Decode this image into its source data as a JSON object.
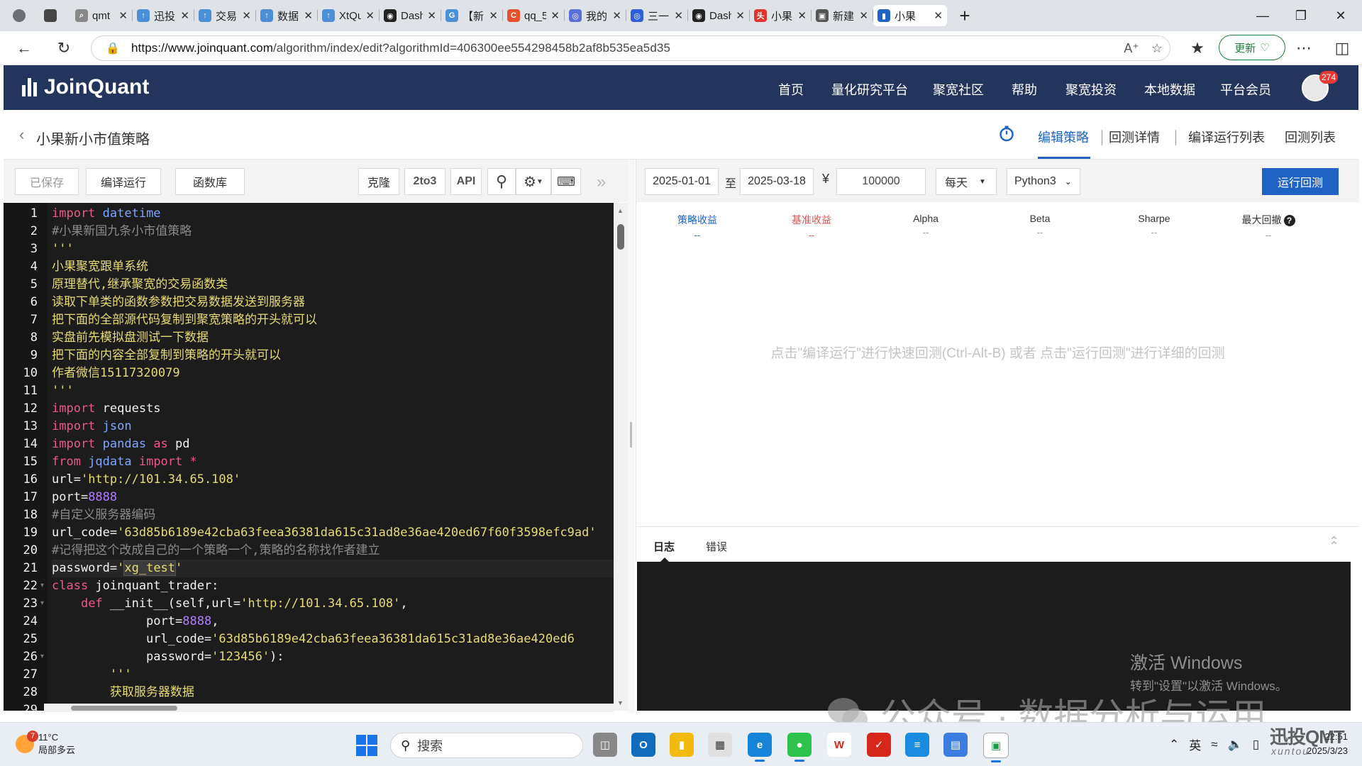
{
  "browser": {
    "tabs": [
      {
        "label": "",
        "icon": "profile-icon",
        "color": "#6b6f75"
      },
      {
        "label": "",
        "icon": "tab-actions-icon",
        "color": "#444444"
      },
      {
        "label": "qmt",
        "icon": "search-icon",
        "color": "#888888"
      },
      {
        "label": "迅投",
        "icon": "xuntou-icon",
        "color": "#4b8fd6"
      },
      {
        "label": "交易",
        "icon": "xuntou-icon",
        "color": "#4b8fd6"
      },
      {
        "label": "数据",
        "icon": "xuntou-icon",
        "color": "#4b8fd6"
      },
      {
        "label": "XtQu",
        "icon": "xuntou-icon",
        "color": "#4b8fd6"
      },
      {
        "label": "Dash",
        "icon": "dash-icon",
        "color": "#222222"
      },
      {
        "label": "【新",
        "icon": "gt-icon",
        "color": "#4b8fd6"
      },
      {
        "label": "qq_5",
        "icon": "csdn-icon",
        "color": "#e8512c"
      },
      {
        "label": "我的",
        "icon": "ai-icon",
        "color": "#5b6fd8"
      },
      {
        "label": "三一",
        "icon": "ai-icon",
        "color": "#2f5fd8"
      },
      {
        "label": "Dash",
        "icon": "dash-icon",
        "color": "#222222"
      },
      {
        "label": "小果",
        "icon": "toutiao-icon",
        "color": "#e5322d"
      },
      {
        "label": "新建",
        "icon": "new-tab-icon",
        "color": "#555555"
      },
      {
        "label": "小果",
        "icon": "joinquant-icon",
        "color": "#1e63c4",
        "active": true
      }
    ],
    "new_tab": "+",
    "url_host": "https://www.joinquant.com",
    "url_path": "/algorithm/index/edit?algorithmId=406300ee554298458b2af8b535ea5d35",
    "update_label": "更新"
  },
  "site": {
    "logo": "JoinQuant",
    "nav": [
      "首页",
      "量化研究平台",
      "聚宽社区",
      "帮助",
      "聚宽投资",
      "本地数据",
      "平台会员"
    ],
    "notification_count": "274"
  },
  "strategy": {
    "title": "小果新小市值策略",
    "subnav": [
      "编辑策略",
      "回测详情",
      "编译运行列表",
      "回测列表"
    ],
    "active_subnav": 0
  },
  "editor_toolbar": {
    "saved": "已保存",
    "compile_run": "编译运行",
    "library": "函数库",
    "clone": "克隆",
    "to3": "2to3",
    "api": "API"
  },
  "code": {
    "lines": [
      [
        [
          "import ",
          "kw"
        ],
        [
          "datetime",
          "mod"
        ]
      ],
      [
        [
          "#小果新国九条小市值策略",
          "cm"
        ]
      ],
      [
        [
          "'''",
          "st"
        ]
      ],
      [
        [
          "小果聚宽跟单系统",
          "st"
        ]
      ],
      [
        [
          "原理替代,继承聚宽的交易函数类",
          "st"
        ]
      ],
      [
        [
          "读取下单类的函数参数把交易数据发送到服务器",
          "st"
        ]
      ],
      [
        [
          "把下面的全部源代码复制到聚宽策略的开头就可以",
          "st"
        ]
      ],
      [
        [
          "实盘前先模拟盘测试一下数据",
          "st"
        ]
      ],
      [
        [
          "把下面的内容全部复制到策略的开头就可以",
          "st"
        ]
      ],
      [
        [
          "作者微信15117320079",
          "st"
        ]
      ],
      [
        [
          "'''",
          "st"
        ]
      ],
      [
        [
          "import ",
          "kw"
        ],
        [
          "requests",
          "tx"
        ]
      ],
      [
        [
          "import ",
          "kw"
        ],
        [
          "json",
          "mod"
        ]
      ],
      [
        [
          "import ",
          "kw"
        ],
        [
          "pandas",
          "mod"
        ],
        [
          " as ",
          "kw"
        ],
        [
          "pd",
          "tx"
        ]
      ],
      [
        [
          "from ",
          "kw"
        ],
        [
          "jqdata",
          "mod"
        ],
        [
          " import ",
          "kw"
        ],
        [
          "*",
          "kw"
        ]
      ],
      [
        [
          "url=",
          "tx"
        ],
        [
          "'http://101.34.65.108'",
          "st"
        ]
      ],
      [
        [
          "port=",
          "tx"
        ],
        [
          "8888",
          "nu"
        ]
      ],
      [
        [
          "#自定义服务器编码",
          "cm"
        ]
      ],
      [
        [
          "url_code=",
          "tx"
        ],
        [
          "'63d85b6189e42cba63feea36381da615c31ad8e36ae420ed67f60f3598efc9ad'",
          "st"
        ]
      ],
      [
        [
          "#记得把这个改成自己的一个策略一个,策略的名称找作者建立",
          "cm"
        ]
      ],
      [
        [
          "password=",
          "tx"
        ],
        [
          "'",
          "st"
        ],
        [
          "xg_test",
          "hl"
        ],
        [
          "'",
          "st"
        ]
      ],
      [
        [
          "class ",
          "kw"
        ],
        [
          "joinquant_trader:",
          "tx"
        ]
      ],
      [
        [
          "    ",
          "tx"
        ],
        [
          "def ",
          "kw"
        ],
        [
          "__init__(self,url=",
          "tx"
        ],
        [
          "'http://101.34.65.108'",
          "st"
        ],
        [
          ",",
          "tx"
        ]
      ],
      [
        [
          "             port=",
          "tx"
        ],
        [
          "8888",
          "nu"
        ],
        [
          ",",
          "tx"
        ]
      ],
      [
        [
          "             url_code=",
          "tx"
        ],
        [
          "'63d85b6189e42cba63feea36381da615c31ad8e36ae420ed6",
          "st"
        ]
      ],
      [
        [
          "             password=",
          "tx"
        ],
        [
          "'123456'",
          "st"
        ],
        [
          "):",
          "tx"
        ]
      ],
      [
        [
          "        ",
          "tx"
        ],
        [
          "'''",
          "st"
        ]
      ],
      [
        [
          "        ",
          "tx"
        ],
        [
          "获取服务器数据",
          "st"
        ]
      ],
      [
        [
          "        ",
          "tx"
        ],
        [
          "'''",
          "st"
        ]
      ]
    ],
    "fold_lines": [
      22,
      23,
      26
    ],
    "current_line": 21
  },
  "backtest": {
    "start_date": "2025-01-01",
    "to_label": "至",
    "end_date": "2025-03-18",
    "currency": "¥",
    "capital": "100000",
    "frequency": "每天",
    "language": "Python3",
    "run_label": "运行回测",
    "metrics": [
      {
        "name": "策略收益",
        "value": "--",
        "color": "#1e63c4"
      },
      {
        "name": "基准收益",
        "value": "--",
        "color": "#d9534f"
      },
      {
        "name": "Alpha",
        "value": "--",
        "color": "#333333"
      },
      {
        "name": "Beta",
        "value": "--",
        "color": "#333333"
      },
      {
        "name": "Sharpe",
        "value": "--",
        "color": "#333333"
      },
      {
        "name": "最大回撤",
        "value": "--",
        "color": "#333333"
      }
    ],
    "hint": "点击\"编译运行\"进行快速回测(Ctrl-Alt-B) 或者 点击\"运行回测\"进行详细的回测"
  },
  "log": {
    "tabs": [
      "日志",
      "错误"
    ]
  },
  "overlay": {
    "activate_title": "激活 Windows",
    "activate_sub": "转到\"设置\"以激活 Windows。",
    "watermark": "公众号 · 数据分析与运用",
    "brand": "迅投QMT",
    "brand_sub": "xuntou"
  },
  "taskbar": {
    "temp": "11°C",
    "weather": "局部多云",
    "weather_badge": "7",
    "search_placeholder": "搜索",
    "ime": "英",
    "time": "22:51",
    "date": "2025/3/23"
  },
  "colors": {
    "header_bg": "#24355d",
    "accent": "#1e63c4",
    "editor_bg": "#1c1c1c",
    "keyword": "#f0578a",
    "module": "#7ea6ff",
    "string": "#e6db74",
    "number": "#b47cff",
    "comment": "#8a8a8a"
  }
}
